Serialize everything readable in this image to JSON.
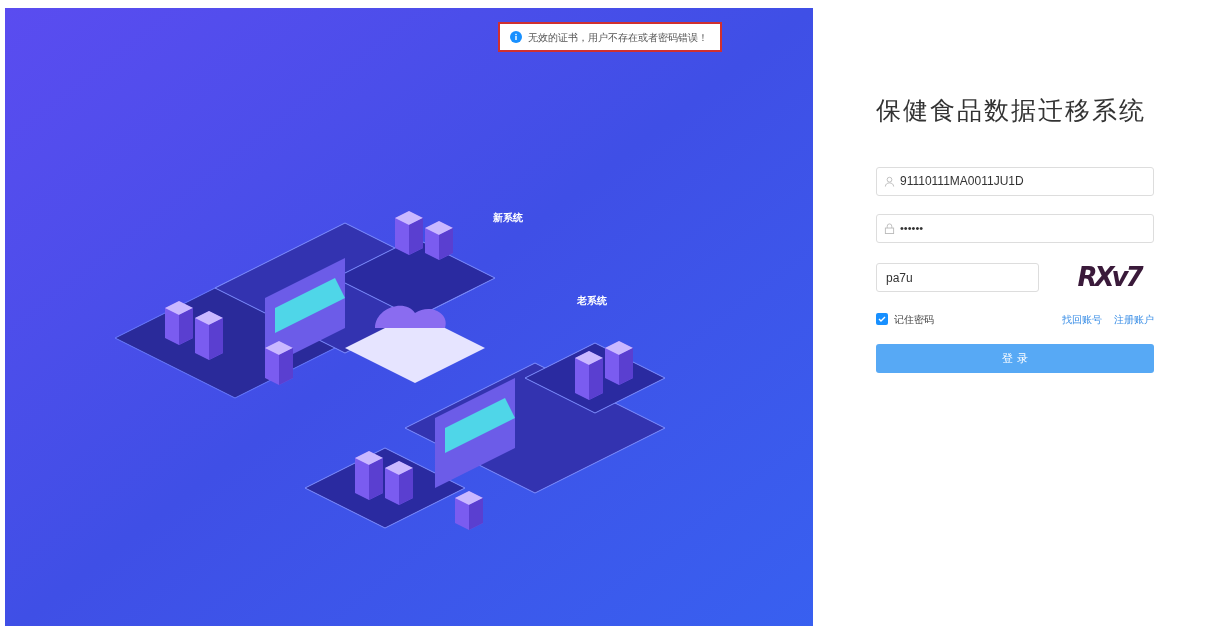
{
  "toast": {
    "message": "无效的证书，用户不存在或者密码错误！"
  },
  "illustration": {
    "labels": [
      "新系统",
      "老系统"
    ]
  },
  "login": {
    "title": "保健食品数据迁移系统",
    "username": {
      "value": "91110111MA0011JU1D"
    },
    "password": {
      "value": "••••••"
    },
    "captcha": {
      "value": "pa7u",
      "image_text": "RXv7"
    },
    "remember": {
      "label": "记住密码",
      "checked": true
    },
    "links": [
      "找回账号",
      "注册账户"
    ],
    "submit": "登 录"
  }
}
